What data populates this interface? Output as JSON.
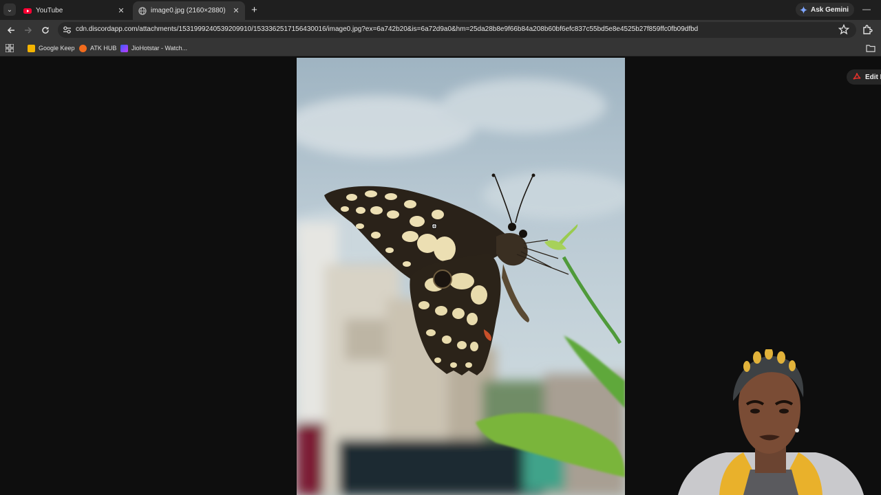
{
  "browser": {
    "tabs": [
      {
        "title": "YouTube",
        "favicon": "youtube-icon",
        "active": false
      },
      {
        "title": "image0.jpg (2160×2880)",
        "favicon": "globe-icon",
        "active": true
      }
    ],
    "ask_gemini_label": "Ask Gemini",
    "url": "cdn.discordapp.com/attachments/1531999240539209910/1533362517156430016/image0.jpg?ex=6a742b20&is=6a72d9a0&hm=25da28b8e9f66b84a208b60bf6efc837c55bd5e8e4525b27f859ffc0fb09dfbd",
    "bookmarks": [
      {
        "label": "Google Keep",
        "icon": "google-keep-icon",
        "color": "#f4b400"
      },
      {
        "label": "ATK HUB",
        "icon": "atk-hub-icon",
        "color": "#f26b1d"
      },
      {
        "label": "JioHotstar - Watch...",
        "icon": "jiohotstar-icon",
        "color": "#6a3df0"
      }
    ]
  },
  "page": {
    "edit_label": "Edit I",
    "image_subject": "butterfly photo"
  },
  "colors": {
    "tabstrip_bg": "#1f1f1f",
    "toolbar_bg": "#353535",
    "page_bg": "#0e0e0e",
    "pdf_red": "#e0312b"
  }
}
